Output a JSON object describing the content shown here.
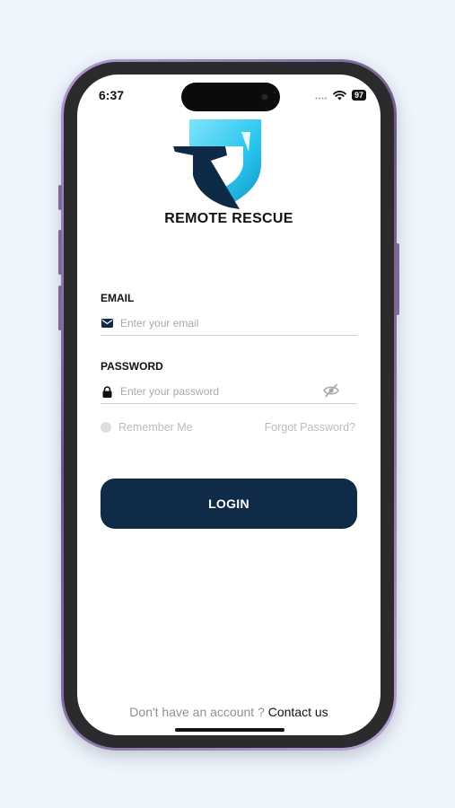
{
  "status_bar": {
    "time": "6:37",
    "battery": "97"
  },
  "brand": {
    "name": "REMOTE RESCUE"
  },
  "form": {
    "email_label": "EMAIL",
    "email_placeholder": "Enter your email",
    "password_label": "PASSWORD",
    "password_placeholder": "Enter your password",
    "remember_label": "Remember Me",
    "forgot_label": "Forgot Password?",
    "login_label": "LOGIN"
  },
  "footer": {
    "question": "Don't have an account ?",
    "link": "Contact us"
  },
  "icons": {
    "email": "envelope-icon",
    "password": "lock-icon",
    "toggle": "eye-off-icon",
    "wifi": "wifi-icon",
    "signal": "signal-icon"
  },
  "colors": {
    "background": "#eef5fc",
    "primary": "#0f2b48",
    "logo_cyan": "#27c6ee",
    "logo_navy": "#0d2a47"
  }
}
